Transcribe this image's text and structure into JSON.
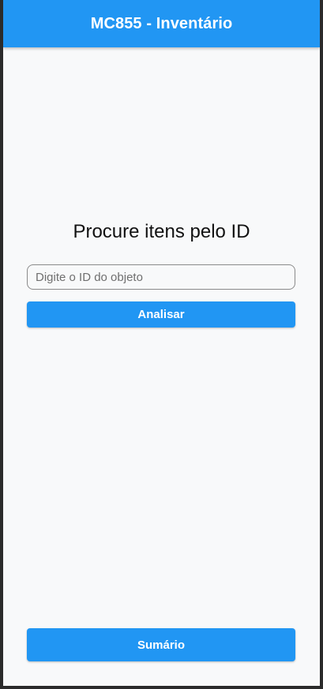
{
  "appbar": {
    "title": "MC855 - Inventário"
  },
  "main": {
    "heading": "Procure itens pelo ID",
    "search": {
      "value": "",
      "placeholder": "Digite o ID do objeto"
    },
    "analyze_label": "Analisar",
    "summary_label": "Sumário"
  },
  "colors": {
    "primary": "#2196f3",
    "background": "#f8f9fa",
    "frame": "#2b2b2b"
  }
}
